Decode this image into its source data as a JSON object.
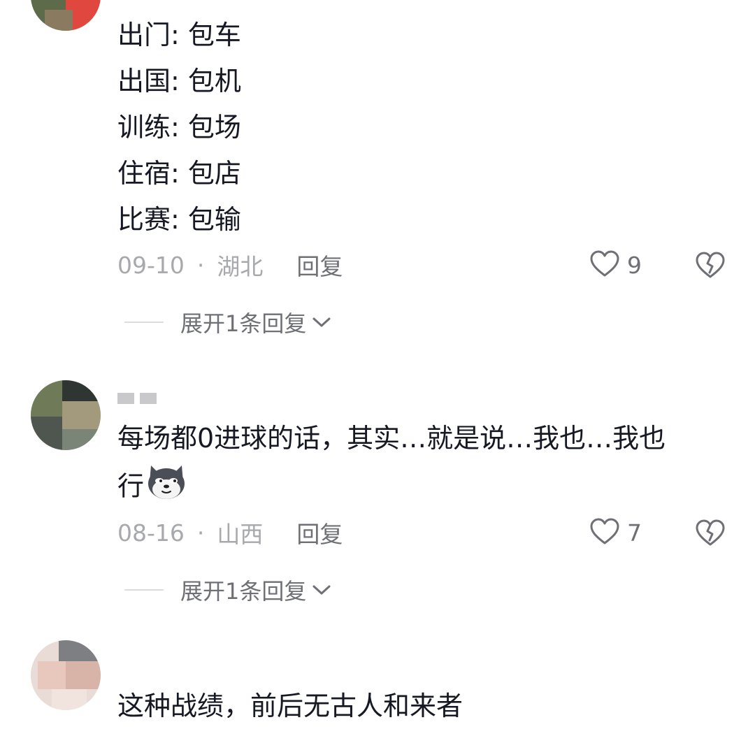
{
  "comments": [
    {
      "lines": [
        "出门: 包车",
        "出国: 包机",
        "训练: 包场",
        "住宿: 包店",
        "比赛: 包输"
      ],
      "date": "09-10",
      "region": "湖北",
      "reply_label": "回复",
      "likes": "9",
      "expand_label": "展开1条回复"
    },
    {
      "lines": [
        "每场都0进球的话，其实…就是说…我也…我也",
        "行"
      ],
      "emoji": "doge-emoji",
      "date": "08-16",
      "region": "山西",
      "reply_label": "回复",
      "likes": "7",
      "expand_label": "展开1条回复"
    },
    {
      "lines": [
        "这种战绩，前后无古人和来者"
      ]
    }
  ],
  "icons": {
    "like": "heart-outline-icon",
    "dislike": "broken-heart-icon",
    "expand": "chevron-down-icon"
  },
  "colors": {
    "text": "#161823",
    "meta": "#a8a9ad",
    "secondary": "#6f7076"
  }
}
